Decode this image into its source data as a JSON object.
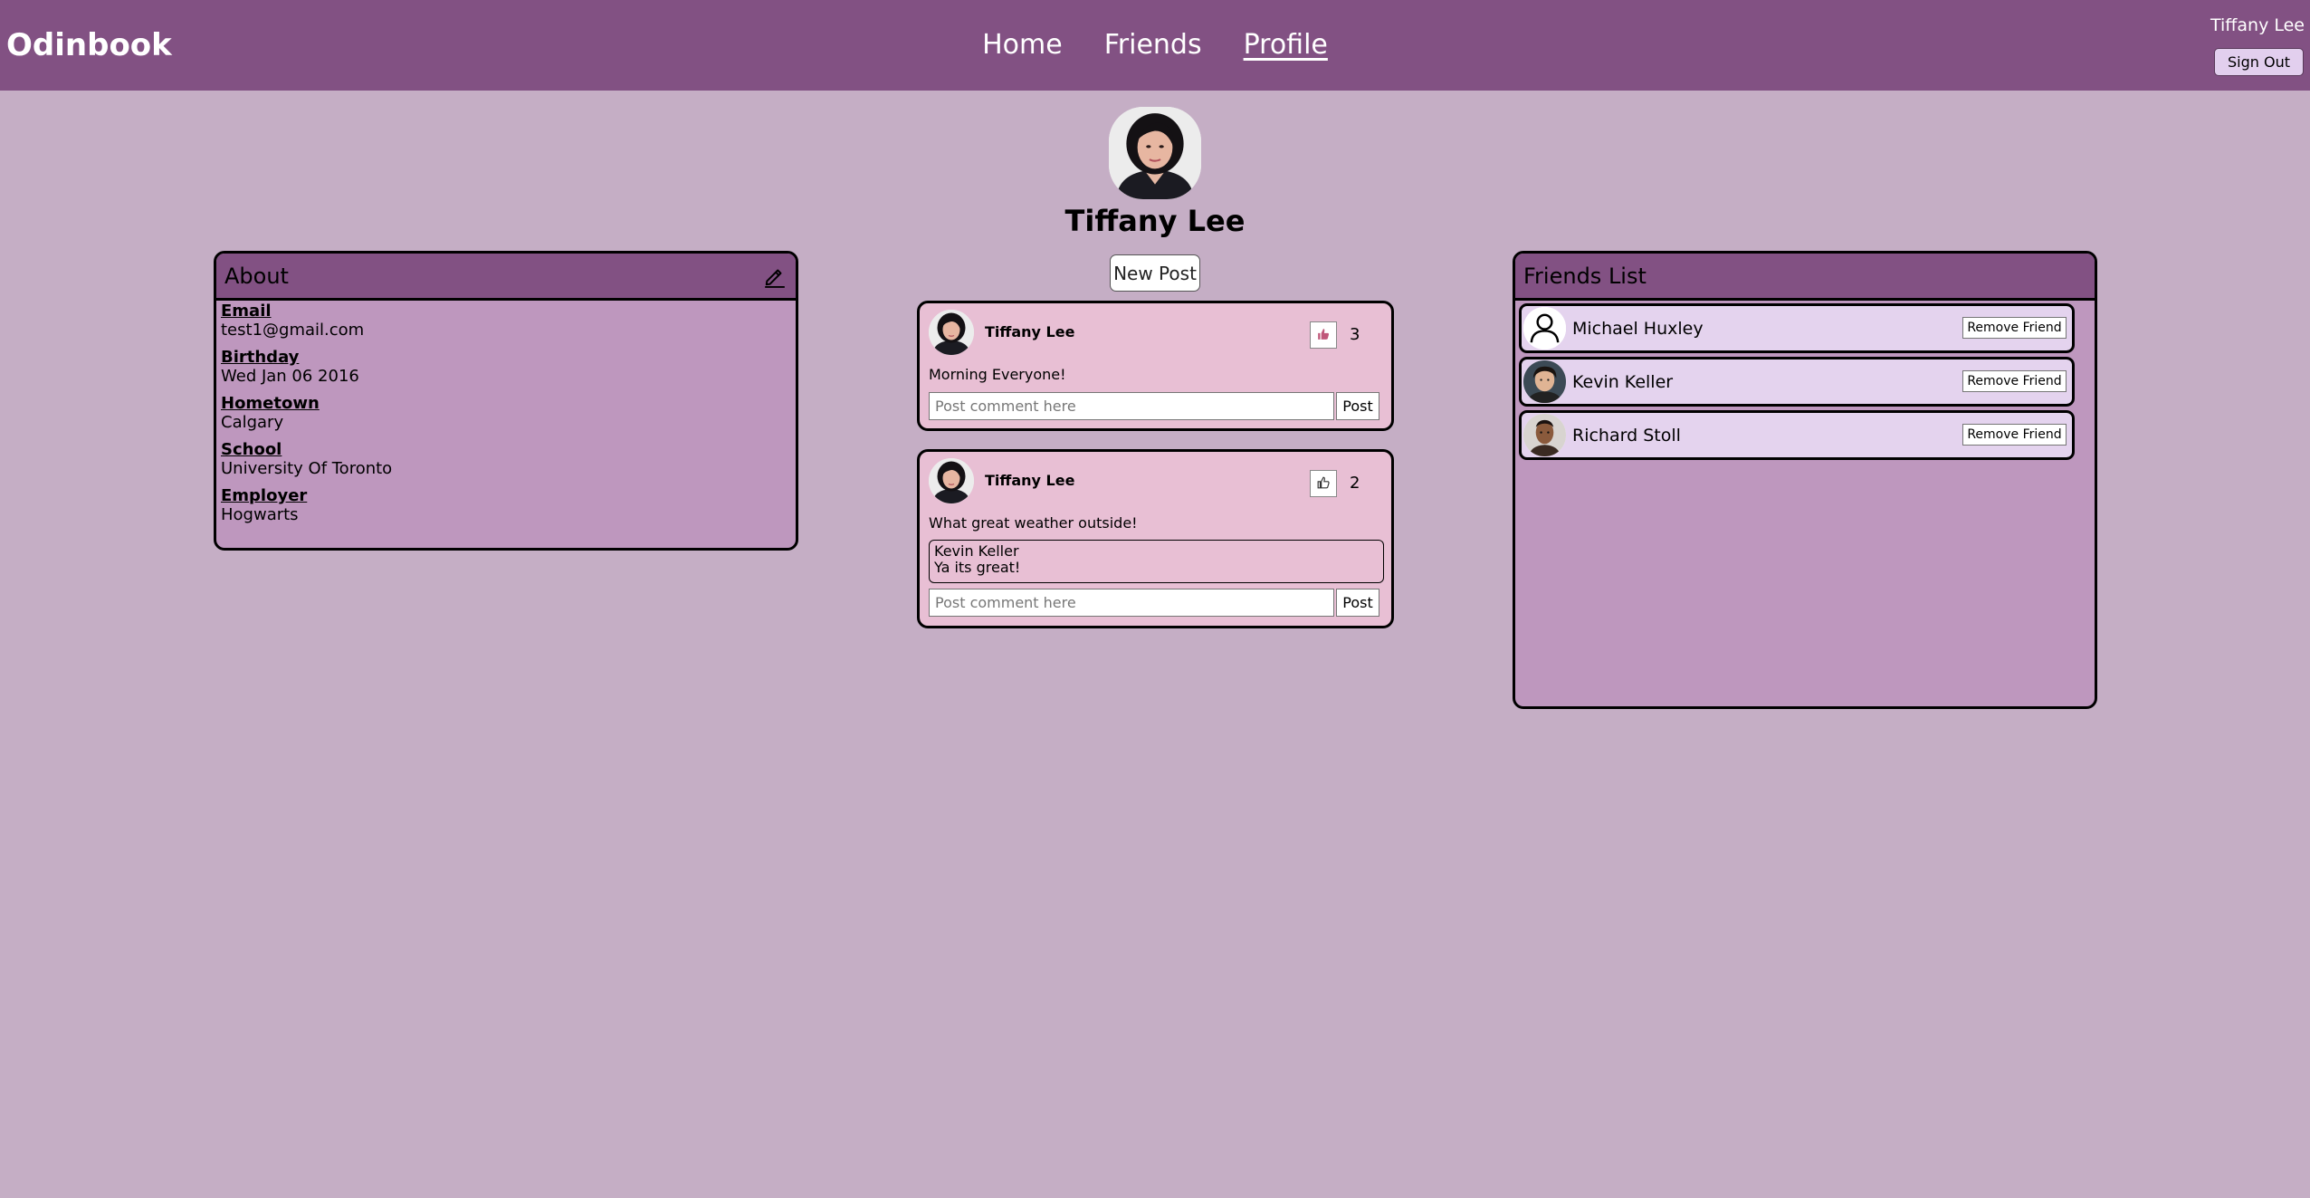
{
  "app": {
    "brand": "Odinbook"
  },
  "nav": {
    "items": [
      {
        "label": "Home",
        "active": false
      },
      {
        "label": "Friends",
        "active": false
      },
      {
        "label": "Profile",
        "active": true
      }
    ]
  },
  "user": {
    "name": "Tiffany Lee",
    "sign_out_label": "Sign Out"
  },
  "profile": {
    "name": "Tiffany Lee",
    "new_post_label": "New Post"
  },
  "about": {
    "title": "About",
    "fields": [
      {
        "label": "Email",
        "value": "test1@gmail.com"
      },
      {
        "label": "Birthday",
        "value": "Wed Jan 06 2016"
      },
      {
        "label": "Hometown",
        "value": "Calgary"
      },
      {
        "label": "School",
        "value": "University Of Toronto"
      },
      {
        "label": "Employer",
        "value": "Hogwarts"
      }
    ]
  },
  "posts": [
    {
      "author": "Tiffany Lee",
      "text": "Morning Everyone!",
      "likes": "3",
      "liked": true,
      "comments": [],
      "comment_placeholder": "Post comment here",
      "comment_button": "Post"
    },
    {
      "author": "Tiffany Lee",
      "text": "What great weather outside!",
      "likes": "2",
      "liked": false,
      "comments": [
        {
          "author": "Kevin Keller",
          "text": "Ya its great!"
        }
      ],
      "comment_placeholder": "Post comment here",
      "comment_button": "Post"
    }
  ],
  "friends": {
    "title": "Friends List",
    "items": [
      {
        "name": "Michael Huxley",
        "avatar": "default-user-icon",
        "action": "Remove Friend"
      },
      {
        "name": "Kevin Keller",
        "avatar": "photo",
        "action": "Remove Friend"
      },
      {
        "name": "Richard Stoll",
        "avatar": "photo",
        "action": "Remove Friend"
      }
    ]
  },
  "colors": {
    "header": "#825183",
    "page_bg": "#c5aec5",
    "panel_bg": "#be97be",
    "post_bg": "#e8bfd4",
    "friend_row_bg": "#e4d3ee",
    "liked_icon": "#c0587a"
  }
}
